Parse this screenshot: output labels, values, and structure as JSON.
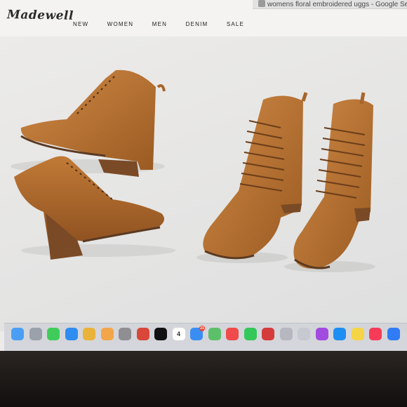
{
  "browser": {
    "tab_title": "womens floral embroidered uggs - Google Se"
  },
  "site": {
    "logo": "Madewell",
    "nav": [
      "NEW",
      "WOMEN",
      "MEN",
      "DENIM",
      "SALE"
    ]
  },
  "colors": {
    "leather": "#b8702e",
    "leather_dark": "#8a4d1c",
    "heel": "#7a4a26",
    "sole": "#5b3a22",
    "background": "#e6e6e5"
  },
  "dock": {
    "apps": [
      {
        "icon": "finder-icon",
        "color": "#4a9ff5"
      },
      {
        "icon": "launchpad-icon",
        "color": "#9aa1ab"
      },
      {
        "icon": "messages-icon",
        "color": "#3fcc5a"
      },
      {
        "icon": "safari-icon",
        "color": "#2f8cf0"
      },
      {
        "icon": "chrome-icon",
        "color": "#e9b23a"
      },
      {
        "icon": "photos-icon",
        "color": "#f3a54a"
      },
      {
        "icon": "settings-icon",
        "color": "#8e8e93"
      },
      {
        "icon": "chrome-icon",
        "color": "#d9473a"
      },
      {
        "icon": "appletv-icon",
        "color": "#111111"
      },
      {
        "icon": "calendar-icon",
        "color": "#ffffff",
        "text": "4"
      },
      {
        "icon": "mail-icon",
        "color": "#3a8ef3",
        "badge": "21"
      },
      {
        "icon": "maps-icon",
        "color": "#5cbf6a"
      },
      {
        "icon": "news-icon",
        "color": "#f04a4a"
      },
      {
        "icon": "facetime-icon",
        "color": "#34c759"
      },
      {
        "icon": "photo-booth-icon",
        "color": "#d63b3b"
      },
      {
        "icon": "preview-icon",
        "color": "#b7b7c2"
      },
      {
        "icon": "notes-list-icon",
        "color": "#c7c9d0"
      },
      {
        "icon": "podcasts-icon",
        "color": "#a24be0"
      },
      {
        "icon": "appstore-icon",
        "color": "#1e8ef5"
      },
      {
        "icon": "notes-icon",
        "color": "#f5d547"
      },
      {
        "icon": "music-icon",
        "color": "#f53b57"
      },
      {
        "icon": "accessibility-icon",
        "color": "#2f7cf6"
      }
    ]
  }
}
